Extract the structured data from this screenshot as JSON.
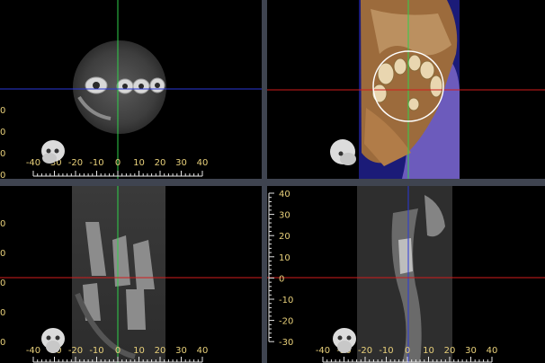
{
  "viewports": {
    "axial": {
      "name": "axial-view",
      "hscale_labels": [
        "-40",
        "-30",
        "-20",
        "-10",
        "0",
        "10",
        "20",
        "30",
        "40"
      ],
      "vscale_labels": [
        "0",
        "0",
        "0",
        "0",
        "0"
      ],
      "crosshair_v_color": "#2fd04a",
      "crosshair_h_color": "#2a38d8"
    },
    "volume_3d": {
      "name": "volume-render-view",
      "crosshair_v_color": "#2fd04a",
      "crosshair_h_color": "#d21c1c"
    },
    "coronal": {
      "name": "coronal-view",
      "hscale_labels": [
        "-40",
        "-30",
        "-20",
        "-10",
        "0",
        "10",
        "20",
        "30",
        "40"
      ],
      "vscale_labels": [
        "0",
        "0",
        "0",
        "0",
        "0"
      ],
      "crosshair_v_color": "#2fd04a",
      "crosshair_h_color": "#d21c1c"
    },
    "sagittal": {
      "name": "sagittal-view",
      "hscale_labels": [
        "-40",
        "-30",
        "-20",
        "-10",
        "0",
        "10",
        "20",
        "30",
        "40"
      ],
      "vscale_labels": [
        "40",
        "30",
        "20",
        "10",
        "0",
        "-10",
        "-20",
        "-30"
      ],
      "crosshair_v_color": "#2a38d8",
      "crosshair_h_color": "#d21c1c"
    }
  },
  "colors": {
    "scale_text": "#e8d07a",
    "separator": "#3f4450",
    "volume_bone": "#b58a5a",
    "volume_soft": "#7a66c8"
  },
  "icons": {
    "orientation": "skull-orientation-icon"
  }
}
